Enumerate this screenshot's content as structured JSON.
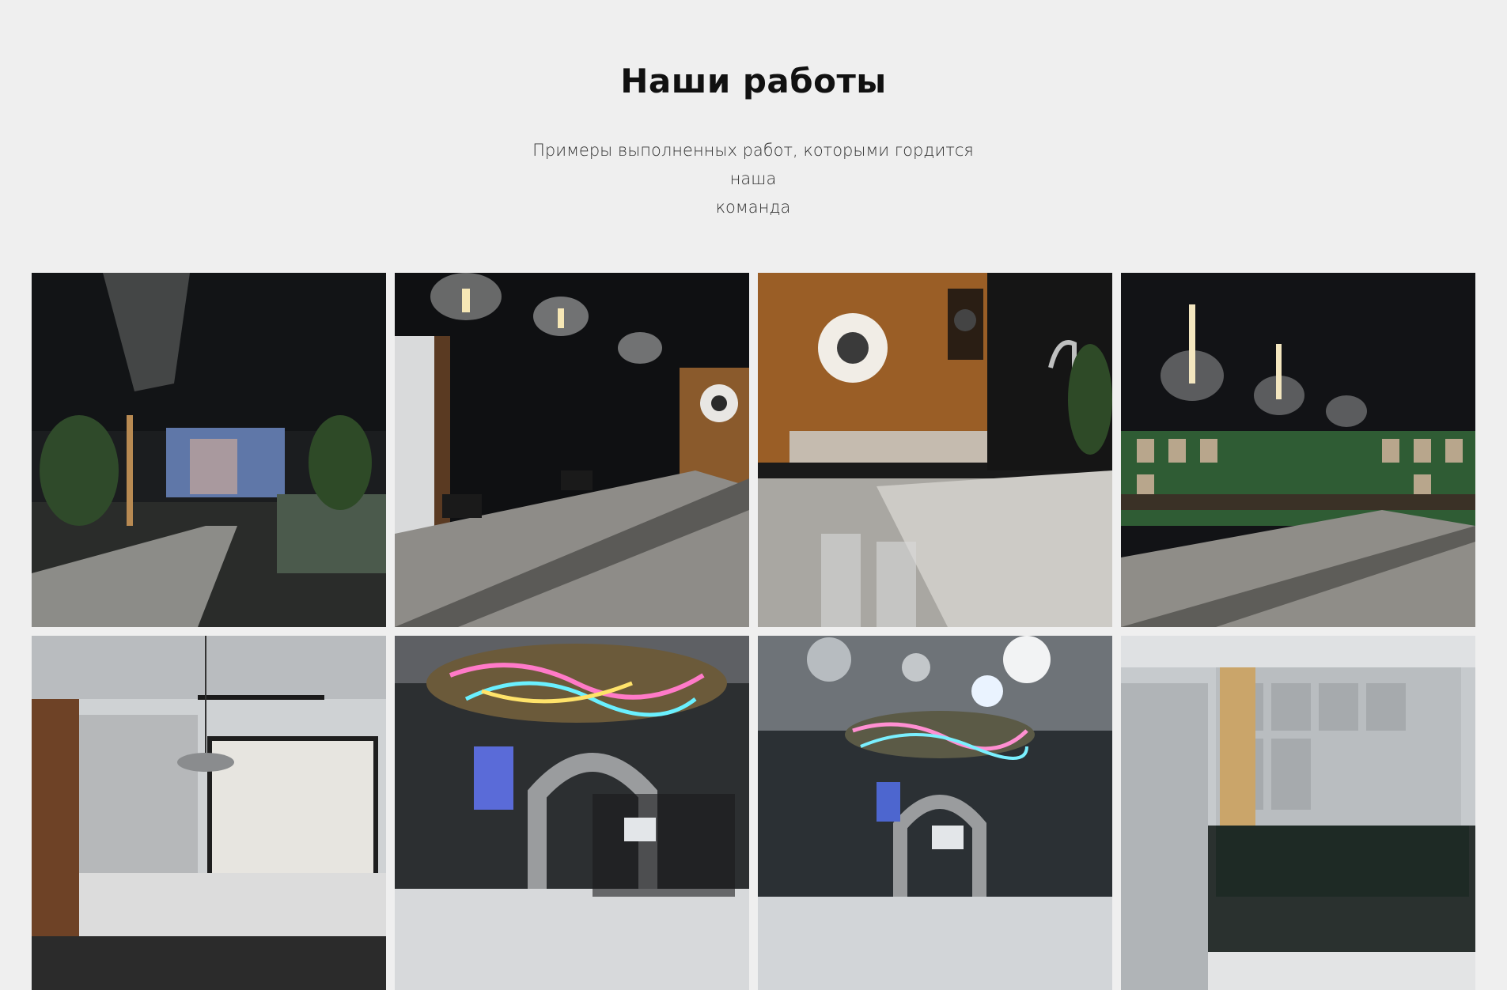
{
  "works": {
    "title": "Наши работы",
    "subtitle_line1": "Примеры выполненных работ, которыми гордится наша",
    "subtitle_line2": "команда"
  },
  "gallery": {
    "items": [
      {
        "subject": "bar with TV and hanging glasses"
      },
      {
        "subject": "bar counter with pendant lamps"
      },
      {
        "subject": "concrete bar with speakers"
      },
      {
        "subject": "bar counter with green shelves"
      },
      {
        "subject": "modern kitchen with pendant lamp"
      },
      {
        "subject": "cafe with neon chandelier"
      },
      {
        "subject": "cafe counter with mirrors"
      },
      {
        "subject": "kitchen with dark tiles"
      }
    ]
  }
}
